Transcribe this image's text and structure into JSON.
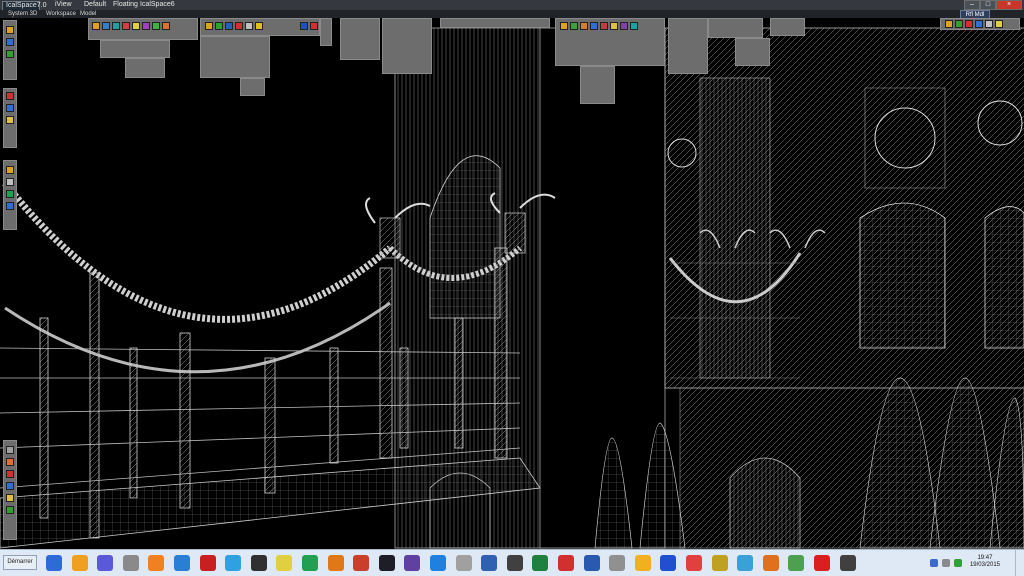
{
  "window": {
    "title": "IcalSpace7.0",
    "view_label": "iView",
    "layout_default": "Default",
    "floating": "Floating",
    "space_name": "IcalSpace6",
    "status_btn": "Rfl Mdl"
  },
  "menu": {
    "items": [
      "System 3D",
      "Workspace",
      "Model"
    ]
  },
  "taskbar": {
    "start_label": "Démarrer",
    "time": "19:47",
    "date": "19/03/2015",
    "app_icons": [
      {
        "name": "app-icon-1",
        "color": "#2f6bd8"
      },
      {
        "name": "app-icon-2",
        "color": "#f0a020"
      },
      {
        "name": "app-icon-3",
        "color": "#5a5ad8"
      },
      {
        "name": "app-icon-4",
        "color": "#8a8a8a"
      },
      {
        "name": "app-icon-5",
        "color": "#f08020"
      },
      {
        "name": "app-icon-6",
        "color": "#2a7fd4"
      },
      {
        "name": "app-icon-7",
        "color": "#c82020"
      },
      {
        "name": "app-icon-8",
        "color": "#30a0e0"
      },
      {
        "name": "app-icon-9",
        "color": "#303030"
      },
      {
        "name": "app-icon-10",
        "color": "#e0d040"
      },
      {
        "name": "app-icon-11",
        "color": "#20a050"
      },
      {
        "name": "app-icon-12",
        "color": "#e07818"
      },
      {
        "name": "app-icon-13",
        "color": "#c8402a"
      },
      {
        "name": "app-icon-14",
        "color": "#1e1e28"
      },
      {
        "name": "app-icon-15",
        "color": "#6040a0"
      },
      {
        "name": "app-icon-16",
        "color": "#2080e0"
      },
      {
        "name": "app-icon-17",
        "color": "#a0a0a0"
      },
      {
        "name": "app-icon-18",
        "color": "#3060b0"
      },
      {
        "name": "app-icon-19",
        "color": "#404040"
      },
      {
        "name": "app-icon-20",
        "color": "#208040"
      },
      {
        "name": "app-icon-21",
        "color": "#d03030"
      },
      {
        "name": "app-icon-22",
        "color": "#2a5ab0"
      },
      {
        "name": "app-icon-23",
        "color": "#909090"
      },
      {
        "name": "app-icon-24",
        "color": "#f0b020"
      },
      {
        "name": "app-icon-25",
        "color": "#2050d0"
      },
      {
        "name": "app-icon-26",
        "color": "#e04040"
      },
      {
        "name": "app-icon-27",
        "color": "#c0a020"
      },
      {
        "name": "app-icon-28",
        "color": "#3aa0d8"
      },
      {
        "name": "app-icon-29",
        "color": "#e07020"
      },
      {
        "name": "app-icon-30",
        "color": "#4ca050"
      },
      {
        "name": "app-icon-31",
        "color": "#d82020"
      },
      {
        "name": "app-icon-32",
        "color": "#404040"
      }
    ]
  }
}
